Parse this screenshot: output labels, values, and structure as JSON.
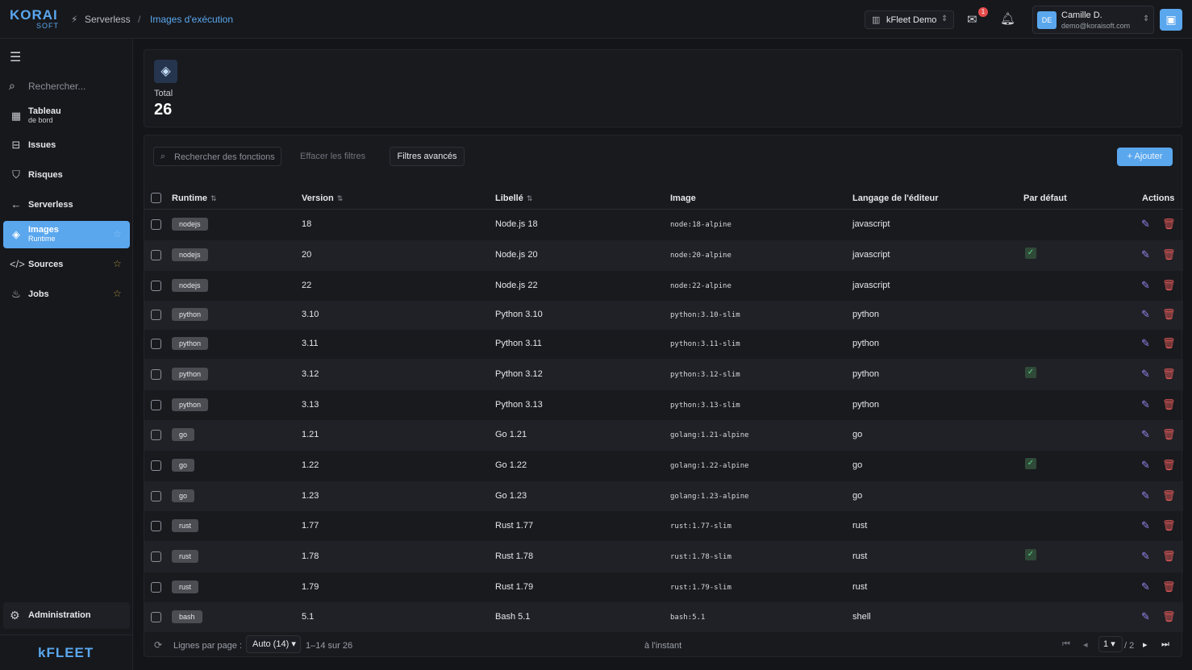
{
  "header": {
    "logo_main": "KORAI",
    "logo_sub": "SOFT",
    "breadcrumb": [
      "Serverless",
      "Images d'exécution"
    ],
    "breadcrumb_sep": "/",
    "tenant": "kFleet Demo",
    "notifications_count": "1",
    "user_initials": "DE",
    "user_name": "Camille D.",
    "user_email": "demo@koraisoft.com"
  },
  "sidebar": {
    "search_placeholder": "Rechercher...",
    "items": [
      {
        "label": "Tableau",
        "sub": "de bord",
        "icon": "dashboard-icon"
      },
      {
        "label": "Issues",
        "sub": "",
        "icon": "ticket-icon"
      },
      {
        "label": "Risques",
        "sub": "",
        "icon": "shield-icon"
      },
      {
        "label": "Serverless",
        "sub": "",
        "icon": "arrow-left-icon"
      },
      {
        "label": "Images",
        "sub": "Runtime",
        "icon": "layers-icon"
      },
      {
        "label": "Sources",
        "sub": "",
        "icon": "code-icon"
      },
      {
        "label": "Jobs",
        "sub": "",
        "icon": "flame-icon"
      }
    ],
    "admin_label": "Administration",
    "brand": "kFLEET"
  },
  "stats": {
    "label": "Total",
    "value": "26"
  },
  "toolbar": {
    "search_placeholder": "Rechercher des fonctions",
    "clear_label": "Effacer les filtres",
    "advanced_label": "Filtres avancés",
    "add_label": "+ Ajouter"
  },
  "table": {
    "headers": {
      "runtime": "Runtime",
      "version": "Version",
      "label": "Libellé",
      "image": "Image",
      "editor_lang": "Langage de l'éditeur",
      "default": "Par défaut",
      "actions": "Actions"
    },
    "rows": [
      {
        "runtime": "nodejs",
        "version": "18",
        "label": "Node.js 18",
        "image": "node:18-alpine",
        "lang": "javascript",
        "default": false
      },
      {
        "runtime": "nodejs",
        "version": "20",
        "label": "Node.js 20",
        "image": "node:20-alpine",
        "lang": "javascript",
        "default": true
      },
      {
        "runtime": "nodejs",
        "version": "22",
        "label": "Node.js 22",
        "image": "node:22-alpine",
        "lang": "javascript",
        "default": false
      },
      {
        "runtime": "python",
        "version": "3.10",
        "label": "Python 3.10",
        "image": "python:3.10-slim",
        "lang": "python",
        "default": false
      },
      {
        "runtime": "python",
        "version": "3.11",
        "label": "Python 3.11",
        "image": "python:3.11-slim",
        "lang": "python",
        "default": false
      },
      {
        "runtime": "python",
        "version": "3.12",
        "label": "Python 3.12",
        "image": "python:3.12-slim",
        "lang": "python",
        "default": true
      },
      {
        "runtime": "python",
        "version": "3.13",
        "label": "Python 3.13",
        "image": "python:3.13-slim",
        "lang": "python",
        "default": false
      },
      {
        "runtime": "go",
        "version": "1.21",
        "label": "Go 1.21",
        "image": "golang:1.21-alpine",
        "lang": "go",
        "default": false
      },
      {
        "runtime": "go",
        "version": "1.22",
        "label": "Go 1.22",
        "image": "golang:1.22-alpine",
        "lang": "go",
        "default": true
      },
      {
        "runtime": "go",
        "version": "1.23",
        "label": "Go 1.23",
        "image": "golang:1.23-alpine",
        "lang": "go",
        "default": false
      },
      {
        "runtime": "rust",
        "version": "1.77",
        "label": "Rust 1.77",
        "image": "rust:1.77-slim",
        "lang": "rust",
        "default": false
      },
      {
        "runtime": "rust",
        "version": "1.78",
        "label": "Rust 1.78",
        "image": "rust:1.78-slim",
        "lang": "rust",
        "default": true
      },
      {
        "runtime": "rust",
        "version": "1.79",
        "label": "Rust 1.79",
        "image": "rust:1.79-slim",
        "lang": "rust",
        "default": false
      },
      {
        "runtime": "bash",
        "version": "5.1",
        "label": "Bash 5.1",
        "image": "bash:5.1",
        "lang": "shell",
        "default": false
      }
    ]
  },
  "footer": {
    "rows_per_page_label": "Lignes par page :",
    "rows_per_page_value": "Auto (14)",
    "range": "1–14 sur 26",
    "updated": "à l'instant",
    "page": "1",
    "page_total": "/ 2"
  },
  "colors": {
    "accent": "#5aa7ee",
    "danger": "#e65a5a",
    "edit": "#9b87f5",
    "success": "#5fd38a"
  }
}
